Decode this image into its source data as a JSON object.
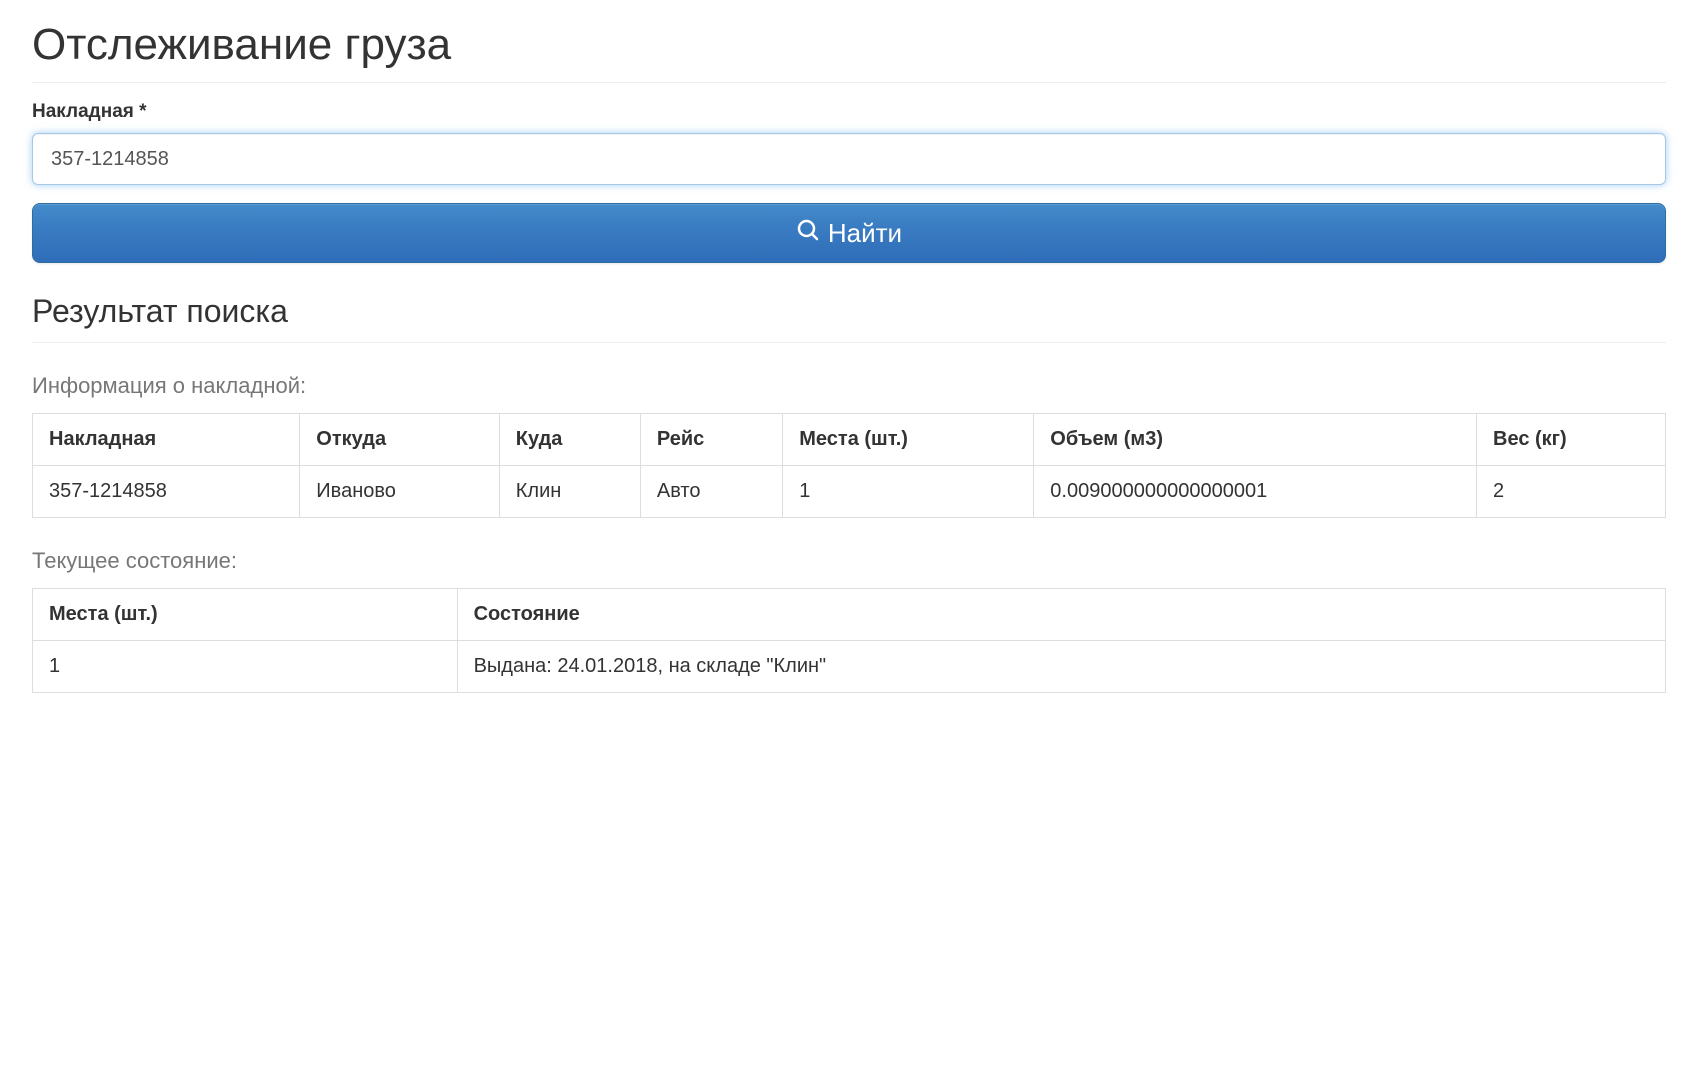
{
  "page_title": "Отслеживание груза",
  "form": {
    "waybill_label": "Накладная *",
    "waybill_value": "357-1214858",
    "search_button_label": "Найти"
  },
  "results": {
    "heading": "Результат поиска",
    "info_heading": "Информация о накладной:",
    "info_table": {
      "headers": {
        "waybill": "Накладная",
        "from": "Откуда",
        "to": "Куда",
        "trip": "Рейс",
        "places": "Места (шт.)",
        "volume": "Объем (м3)",
        "weight": "Вес (кг)"
      },
      "row": {
        "waybill": "357-1214858",
        "from": "Иваново",
        "to": "Клин",
        "trip": "Авто",
        "places": "1",
        "volume": "0.009000000000000001",
        "weight": "2"
      }
    },
    "status_heading": "Текущее состояние:",
    "status_table": {
      "headers": {
        "places": "Места (шт.)",
        "state": "Состояние"
      },
      "row": {
        "places": "1",
        "state": "Выдана: 24.01.2018, на складе \"Клин\""
      }
    }
  }
}
